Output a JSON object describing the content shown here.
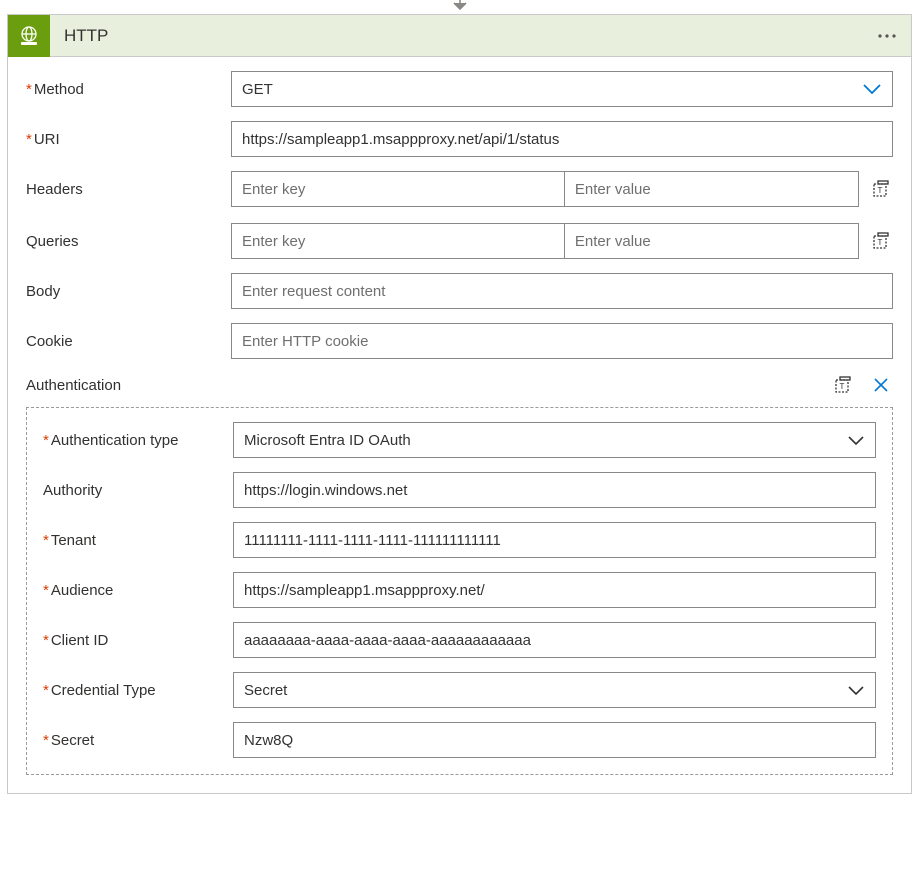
{
  "header": {
    "title": "HTTP"
  },
  "fields": {
    "method_label": "Method",
    "method_value": "GET",
    "uri_label": "URI",
    "uri_value": "https://sampleapp1.msappproxy.net/api/1/status",
    "headers_label": "Headers",
    "headers_key_placeholder": "Enter key",
    "headers_value_placeholder": "Enter value",
    "queries_label": "Queries",
    "queries_key_placeholder": "Enter key",
    "queries_value_placeholder": "Enter value",
    "body_label": "Body",
    "body_placeholder": "Enter request content",
    "cookie_label": "Cookie",
    "cookie_placeholder": "Enter HTTP cookie"
  },
  "auth": {
    "section_label": "Authentication",
    "type_label": "Authentication type",
    "type_value": "Microsoft Entra ID OAuth",
    "authority_label": "Authority",
    "authority_value": "https://login.windows.net",
    "tenant_label": "Tenant",
    "tenant_value": "11111111-1111-1111-1111-111111111111",
    "audience_label": "Audience",
    "audience_value": "https://sampleapp1.msappproxy.net/",
    "clientid_label": "Client ID",
    "clientid_value": "aaaaaaaa-aaaa-aaaa-aaaa-aaaaaaaaaaaa",
    "credtype_label": "Credential Type",
    "credtype_value": "Secret",
    "secret_label": "Secret",
    "secret_value": "Nzw8Q"
  }
}
